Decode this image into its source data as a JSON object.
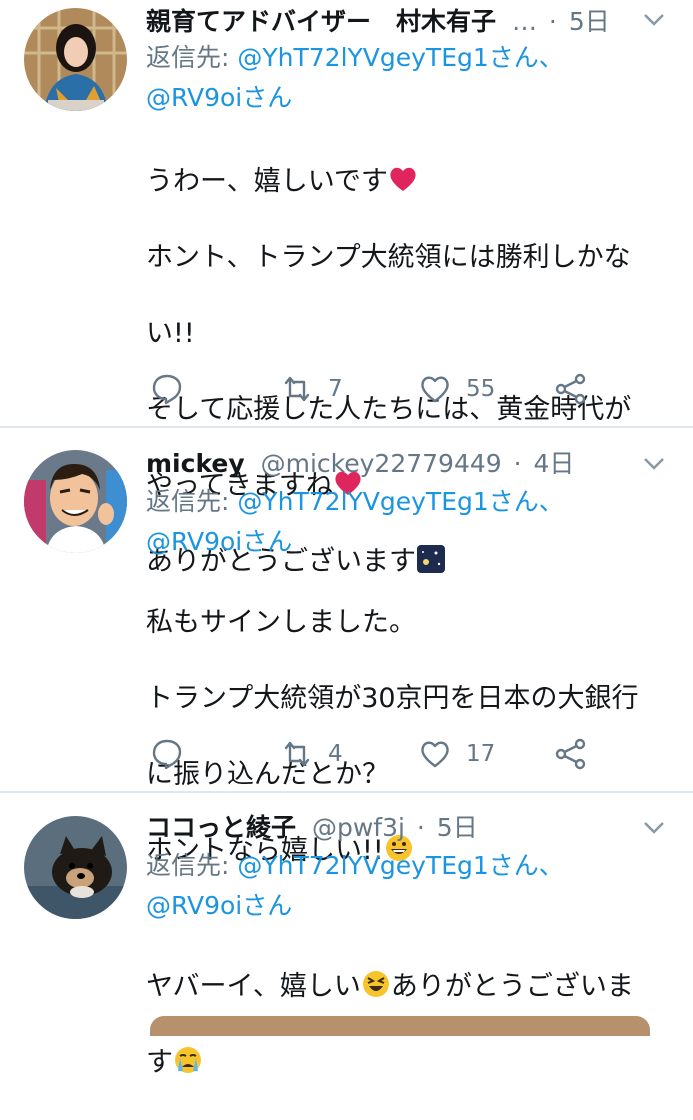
{
  "tweets": [
    {
      "name": "親育てアドバイザー　村木有子",
      "handle": "",
      "truncated": "…",
      "sep": "·",
      "time": "5日",
      "reply_prefix": "返信先: ",
      "reply_to_1": "@YhT72lYVgeyTEg1さん、",
      "reply_to_2": "@RV9oiさん",
      "lines": [
        "うわー、嬉しいです",
        "ホント、トランプ大統領には勝利しかな",
        "い!!",
        "そして応援した人たちには、黄金時代が",
        "やってきますね",
        "ありがとうございます"
      ],
      "retweets": "7",
      "likes": "55",
      "avatar_icon": "woman-avatar"
    },
    {
      "name": "mickey",
      "handle": "@mickey22779449",
      "sep": "·",
      "time": "4日",
      "reply_prefix": "返信先: ",
      "reply_to_1": "@YhT72lYVgeyTEg1さん、",
      "reply_to_2": "@RV9oiさん",
      "lines": [
        "私もサインしました。",
        "トランプ大統領が30京円を日本の大銀行",
        "に振り込んだとか？",
        "ホントなら嬉しい!!"
      ],
      "retweets": "4",
      "likes": "17",
      "avatar_icon": "cartoon-man-avatar"
    },
    {
      "name": "ココっと綾子",
      "handle": "@pwf3j",
      "sep": "·",
      "time": "5日",
      "reply_prefix": "返信先: ",
      "reply_to_1": "@YhT72lYVgeyTEg1さん、",
      "reply_to_2": "@RV9oiさん",
      "lines": [
        "ヤバーイ、嬉しい",
        "ありがとうございま",
        "す"
      ],
      "avatar_icon": "dog-avatar"
    }
  ],
  "colors": {
    "text": "#14171a",
    "muted": "#657786",
    "link": "#1b95e0",
    "divider": "#e1e8ed",
    "heart_emoji": "#e0245e"
  },
  "icons": {
    "reply": "reply-icon",
    "retweet": "retweet-icon",
    "like": "like-icon",
    "share": "share-icon",
    "menu": "chevron-down-icon"
  }
}
